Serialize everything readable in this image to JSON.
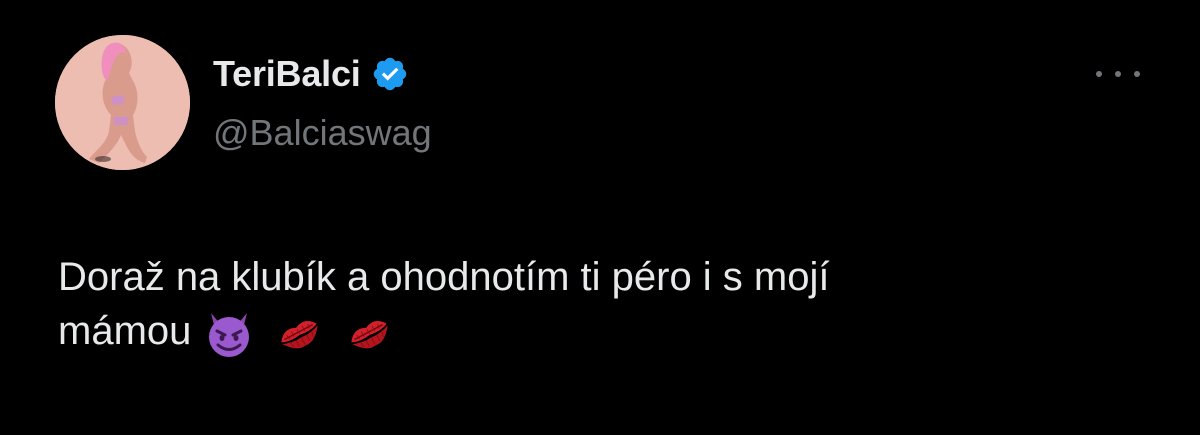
{
  "tweet": {
    "author": {
      "display_name": "TeriBalci",
      "handle": "@Balciaswag",
      "verified": true,
      "verified_color": "#1d9bf0"
    },
    "text_line_1": "Doraž na klubík a ohodnotím ti péro i s mojí",
    "text_line_2": "mámou",
    "emojis": [
      "smiling-devil-emoji",
      "kiss-mark-emoji",
      "kiss-mark-emoji"
    ],
    "more_icon": "more-options-icon"
  },
  "colors": {
    "background": "#000000",
    "primary_text": "#e7e9ea",
    "secondary_text": "#71767b",
    "accent": "#1d9bf0"
  }
}
